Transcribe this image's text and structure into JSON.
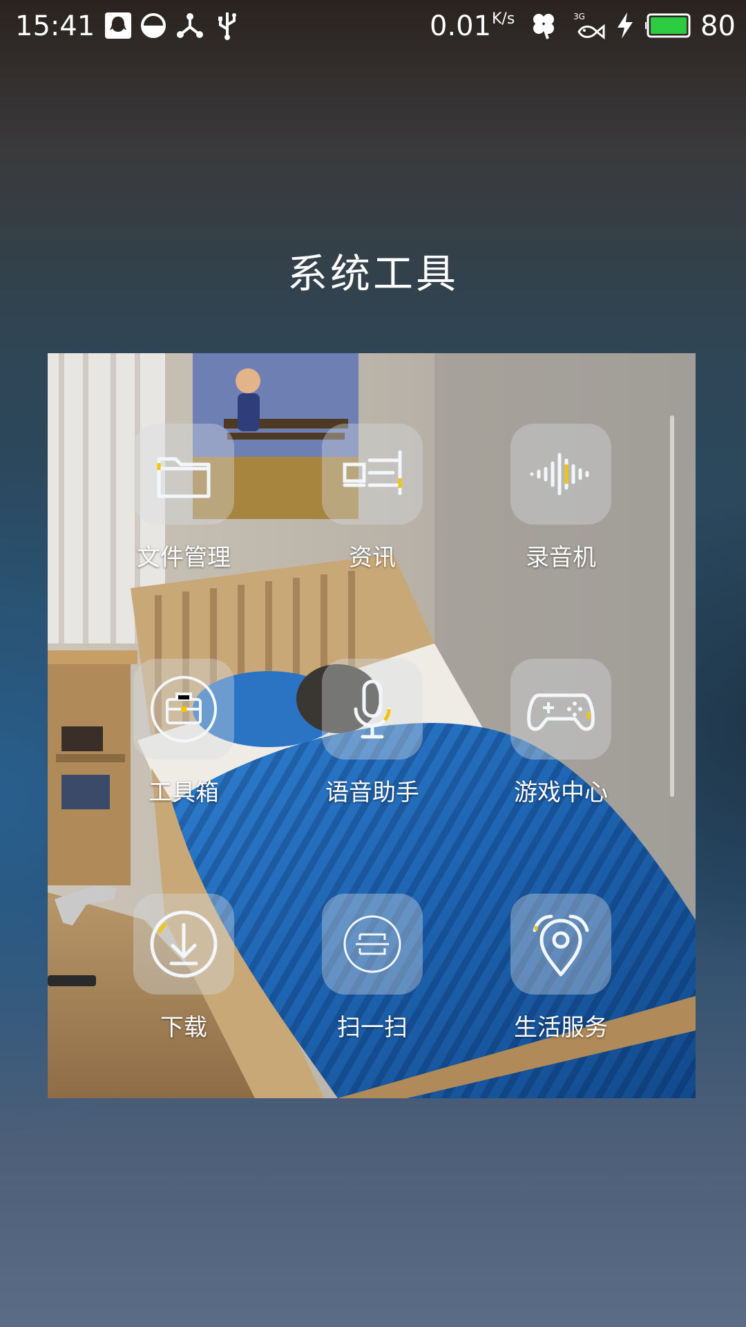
{
  "status_bar": {
    "time": "15:41",
    "speed": "0.01",
    "speed_unit": "K/s",
    "network": "3G",
    "battery_percent": "80",
    "icons": [
      "qq-icon",
      "data-saver-icon",
      "share-icon",
      "usb-icon",
      "clover-icon",
      "signal-fish-icon",
      "charging-icon",
      "battery-icon"
    ]
  },
  "folder": {
    "title": "系统工具",
    "apps": [
      {
        "label": "文件管理",
        "icon": "folder-icon"
      },
      {
        "label": "资讯",
        "icon": "news-icon"
      },
      {
        "label": "录音机",
        "icon": "sound-wave-icon"
      },
      {
        "label": "工具箱",
        "icon": "toolbox-icon"
      },
      {
        "label": "语音助手",
        "icon": "microphone-icon"
      },
      {
        "label": "游戏中心",
        "icon": "gamepad-icon"
      },
      {
        "label": "下载",
        "icon": "download-icon"
      },
      {
        "label": "扫一扫",
        "icon": "scan-icon"
      },
      {
        "label": "生活服务",
        "icon": "location-pin-icon"
      }
    ]
  },
  "colors": {
    "battery_fill": "#2ecc40",
    "icon_stroke": "#f2f7fb",
    "icon_accent": "#f1c40f",
    "bed_blue": "#1d63b0"
  }
}
